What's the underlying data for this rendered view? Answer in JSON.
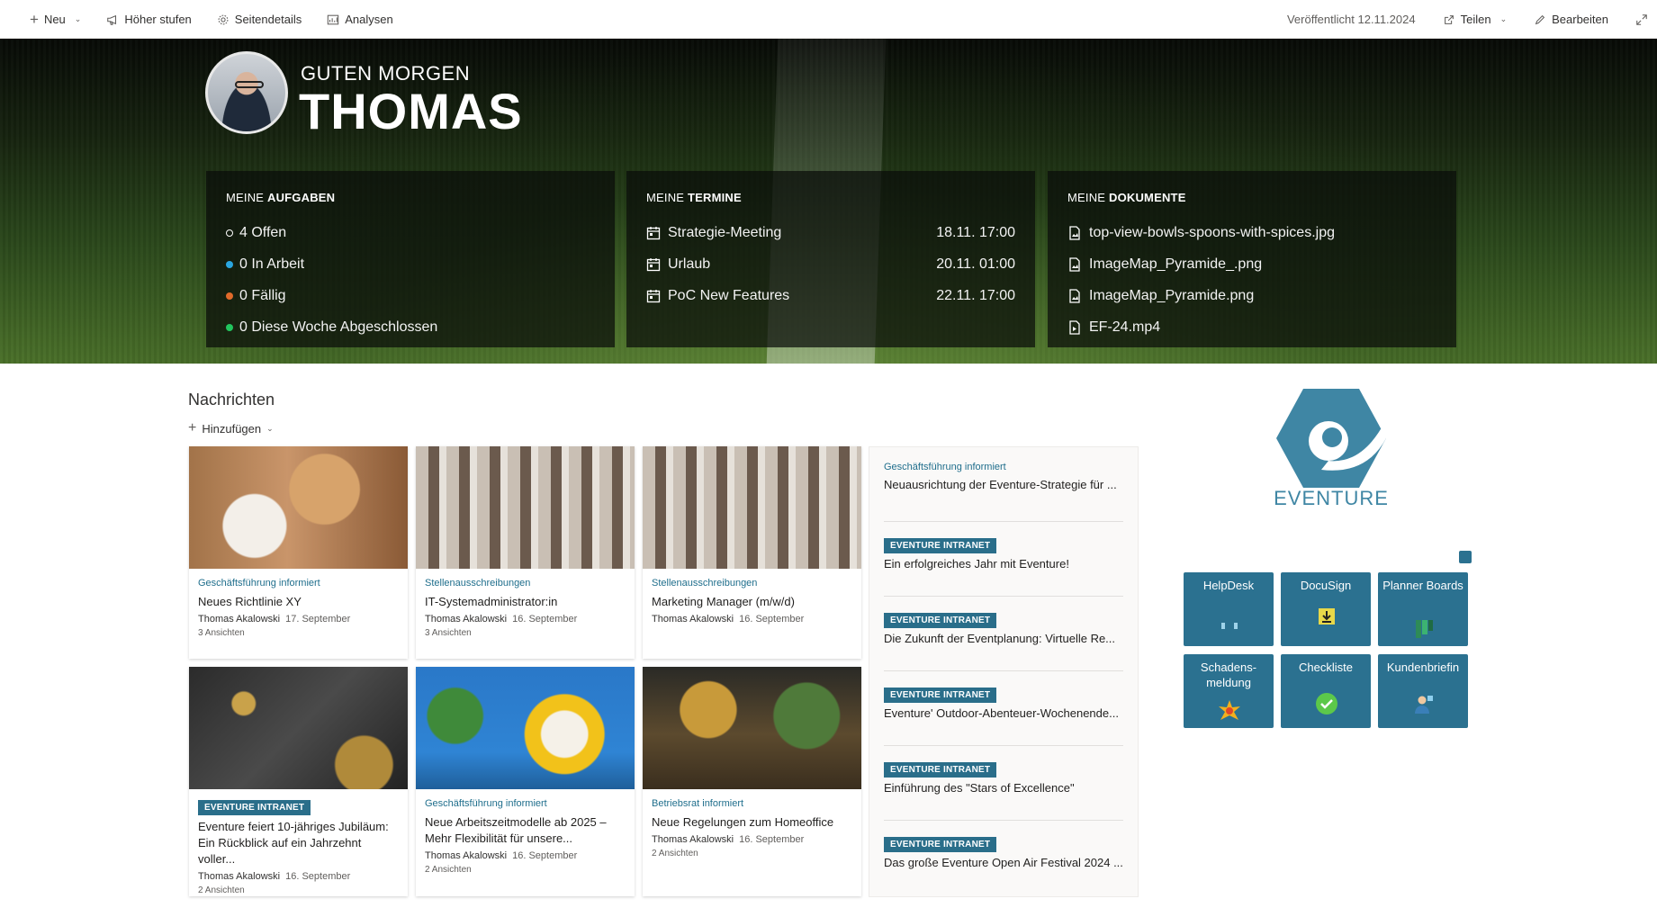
{
  "commandbar": {
    "new": "Neu",
    "promote": "Höher stufen",
    "page_details": "Seitendetails",
    "analytics": "Analysen",
    "published": "Veröffentlicht 12.11.2024",
    "share": "Teilen",
    "edit": "Bearbeiten"
  },
  "hero": {
    "greeting": "GUTEN MORGEN",
    "name": "THOMAS",
    "tasks": {
      "title_prefix": "MEINE",
      "title_bold": "AUFGABEN",
      "items": [
        {
          "label": "4 Offen",
          "color": "#ffffff"
        },
        {
          "label": "0 In Arbeit",
          "color": "#2aa6e0"
        },
        {
          "label": "0 Fällig",
          "color": "#e06a2a"
        },
        {
          "label": "0 Diese Woche Abgeschlossen",
          "color": "#22c55e"
        }
      ]
    },
    "appointments": {
      "title_prefix": "MEINE",
      "title_bold": "TERMINE",
      "items": [
        {
          "label": "Strategie-Meeting",
          "date": "18.11. 17:00"
        },
        {
          "label": "Urlaub",
          "date": "20.11. 01:00"
        },
        {
          "label": "PoC New Features",
          "date": "22.11. 17:00"
        }
      ]
    },
    "documents": {
      "title_prefix": "MEINE",
      "title_bold": "DOKUMENTE",
      "items": [
        {
          "label": "top-view-bowls-spoons-with-spices.jpg"
        },
        {
          "label": "ImageMap_Pyramide_.png"
        },
        {
          "label": "ImageMap_Pyramide.png"
        },
        {
          "label": "EF-24.mp4"
        }
      ]
    }
  },
  "news": {
    "title": "Nachrichten",
    "add": "Hinzufügen",
    "cards": [
      {
        "category": "Geschäftsführung informiert",
        "badge": "",
        "title": "Neues Richtlinie XY",
        "author": "Thomas Akalowski",
        "date": "17. September",
        "views": "3 Ansichten"
      },
      {
        "category": "Stellenausschreibungen",
        "badge": "",
        "title": "IT-Systemadministrator:in",
        "author": "Thomas Akalowski",
        "date": "16. September",
        "views": "3 Ansichten"
      },
      {
        "category": "Stellenausschreibungen",
        "badge": "",
        "title": "Marketing Manager (m/w/d)",
        "author": "Thomas Akalowski",
        "date": "16. September",
        "views": ""
      },
      {
        "category": "",
        "badge": "EVENTURE INTRANET",
        "title": "Eventure feiert 10-jähriges Jubiläum: Ein Rückblick auf ein Jahrzehnt voller...",
        "author": "Thomas Akalowski",
        "date": "16. September",
        "views": "2 Ansichten"
      },
      {
        "category": "Geschäftsführung informiert",
        "badge": "",
        "title": "Neue Arbeitszeitmodelle ab 2025 – Mehr Flexibilität für unsere...",
        "author": "Thomas Akalowski",
        "date": "16. September",
        "views": "2 Ansichten"
      },
      {
        "category": "Betriebsrat informiert",
        "badge": "",
        "title": "Neue Regelungen zum Homeoffice",
        "author": "Thomas Akalowski",
        "date": "16. September",
        "views": "2 Ansichten"
      }
    ],
    "list": [
      {
        "category": "Geschäftsführung informiert",
        "badge": "",
        "title": "Neuausrichtung der Eventure-Strategie für ..."
      },
      {
        "category": "",
        "badge": "EVENTURE INTRANET",
        "title": "Ein erfolgreiches Jahr mit Eventure!"
      },
      {
        "category": "",
        "badge": "EVENTURE INTRANET",
        "title": "Die Zukunft der Eventplanung: Virtuelle Re..."
      },
      {
        "category": "",
        "badge": "EVENTURE INTRANET",
        "title": "Eventure' Outdoor-Abenteuer-Wochenende..."
      },
      {
        "category": "",
        "badge": "EVENTURE INTRANET",
        "title": "Einführung des \"Stars of Excellence\""
      },
      {
        "category": "",
        "badge": "EVENTURE INTRANET",
        "title": "Das große Eventure Open Air Festival 2024 ..."
      }
    ]
  },
  "brand": {
    "logo_text": "EVENTURE",
    "accent": "#2b7190"
  },
  "tiles": [
    {
      "label": "HelpDesk",
      "icon": "headset-icon"
    },
    {
      "label": "DocuSign",
      "icon": "download-icon"
    },
    {
      "label": "Planner Boards",
      "icon": "planner-icon"
    },
    {
      "label": "Schadens-meldung",
      "icon": "damage-icon"
    },
    {
      "label": "Checkliste",
      "icon": "check-icon"
    },
    {
      "label": "Kundenbriefin",
      "icon": "person-icon"
    }
  ]
}
